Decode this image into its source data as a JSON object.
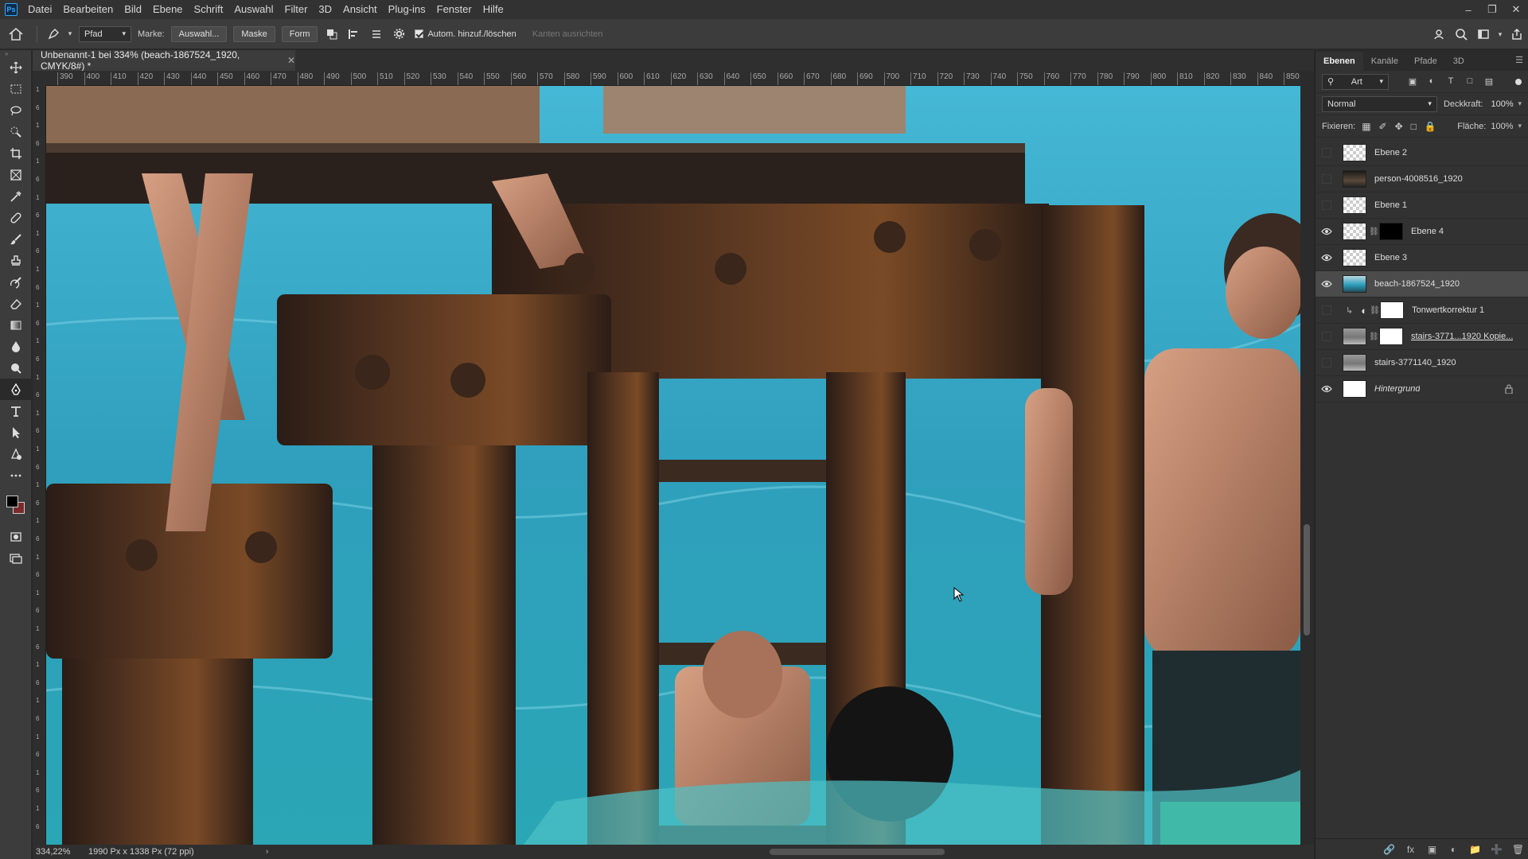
{
  "menu": [
    "Datei",
    "Bearbeiten",
    "Bild",
    "Ebene",
    "Schrift",
    "Auswahl",
    "Filter",
    "3D",
    "Ansicht",
    "Plug-ins",
    "Fenster",
    "Hilfe"
  ],
  "app_logo": "Ps",
  "options": {
    "mode": "Pfad",
    "marke_label": "Marke:",
    "auswahl_button": "Auswahl...",
    "maske_button": "Maske",
    "form_button": "Form",
    "auto_add_delete": "Autom. hinzuf./löschen",
    "align_edges": "Kanten ausrichten"
  },
  "document": {
    "tab_title": "Unbenannt-1 bei 334% (beach-1867524_1920, CMYK/8#) *",
    "zoom": "334,22%",
    "doc_info": "1990 Px x 1338 Px (72 ppi)"
  },
  "ruler_h": [
    "390",
    "400",
    "410",
    "420",
    "430",
    "440",
    "450",
    "460",
    "470",
    "480",
    "490",
    "500",
    "510",
    "520",
    "530",
    "540",
    "550",
    "560",
    "570",
    "580",
    "590",
    "600",
    "610",
    "620",
    "630",
    "640",
    "650",
    "660",
    "670",
    "680",
    "690",
    "700",
    "710",
    "720",
    "730",
    "740",
    "750",
    "760",
    "770",
    "780",
    "790",
    "800",
    "810",
    "820",
    "830",
    "840",
    "850"
  ],
  "ruler_v": [
    "1",
    "6",
    "1",
    "6",
    "1",
    "6",
    "1",
    "6",
    "1",
    "6",
    "1",
    "6",
    "1",
    "6",
    "1",
    "6",
    "1",
    "6",
    "1",
    "6",
    "1",
    "6",
    "1",
    "6",
    "1",
    "6",
    "1",
    "6",
    "1",
    "6",
    "1",
    "6",
    "1",
    "6",
    "1",
    "6",
    "1",
    "6",
    "1",
    "6",
    "1",
    "6"
  ],
  "panel": {
    "tabs": [
      "Ebenen",
      "Kanäle",
      "Pfade",
      "3D"
    ],
    "filter_kind": "Art",
    "blend_mode": "Normal",
    "opacity_label": "Deckkraft:",
    "opacity_value": "100%",
    "lock_label": "Fixieren:",
    "fill_label": "Fläche:",
    "fill_value": "100%"
  },
  "layers": [
    {
      "name": "Ebene 2",
      "visible": false,
      "thumb": "transparent",
      "mask": null,
      "selected": false
    },
    {
      "name": "person-4008516_1920",
      "visible": false,
      "thumb": "photo1",
      "mask": null,
      "selected": false
    },
    {
      "name": "Ebene 1",
      "visible": false,
      "thumb": "transparent",
      "mask": null,
      "selected": false
    },
    {
      "name": "Ebene 4",
      "visible": true,
      "thumb": "transparent",
      "mask": "black",
      "selected": false
    },
    {
      "name": "Ebene 3",
      "visible": true,
      "thumb": "transparent",
      "mask": null,
      "selected": false
    },
    {
      "name": "beach-1867524_1920",
      "visible": true,
      "thumb": "photo2",
      "mask": null,
      "selected": true
    },
    {
      "name": "Tonwertkorrektur 1",
      "visible": false,
      "thumb": "adjust",
      "mask": "white",
      "selected": false
    },
    {
      "name": "stairs-3771...1920 Kopie...",
      "visible": false,
      "thumb": "gray",
      "mask": "white",
      "selected": false
    },
    {
      "name": "stairs-3771140_1920",
      "visible": false,
      "thumb": "gray",
      "mask": null,
      "selected": false
    },
    {
      "name": "Hintergrund",
      "visible": true,
      "thumb": "white",
      "mask": null,
      "selected": false,
      "locked": true
    }
  ],
  "colors": {
    "foreground": "#000000",
    "background": "#7b2b2b",
    "accent": "#31a8ff"
  }
}
